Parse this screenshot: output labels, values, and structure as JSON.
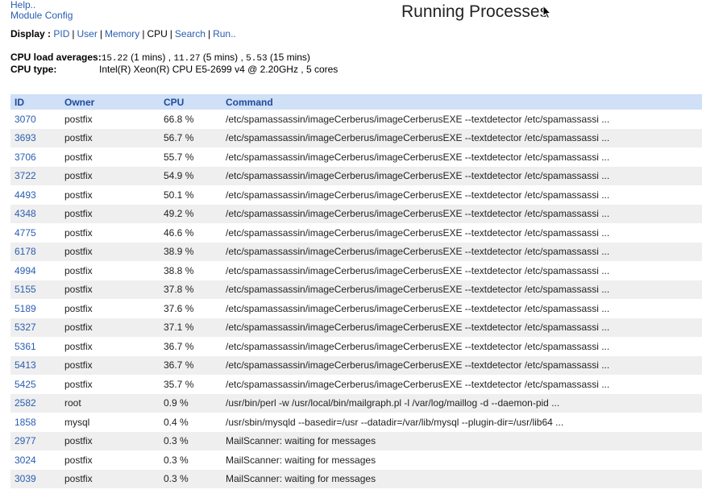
{
  "top_links": {
    "help": "Help..",
    "module_config": "Module Config"
  },
  "page_title": "Running Processes",
  "display": {
    "label": "Display :",
    "modes": [
      {
        "label": "PID",
        "current": false
      },
      {
        "label": "User",
        "current": false
      },
      {
        "label": "Memory",
        "current": false
      },
      {
        "label": "CPU",
        "current": true
      },
      {
        "label": "Search",
        "current": false
      },
      {
        "label": "Run..",
        "current": false
      }
    ]
  },
  "cpu": {
    "load_label": "CPU load averages:",
    "load_1": "15.22",
    "load_1_unit": "(1 mins)",
    "load_5": "11.27",
    "load_5_unit": "(5 mins)",
    "load_15": "5.53",
    "load_15_unit": "(15 mins)",
    "type_label": "CPU type:",
    "type_value": "Intel(R) Xeon(R) CPU E5-2699 v4 @ 2.20GHz , 5 cores"
  },
  "table": {
    "headers": [
      "ID",
      "Owner",
      "CPU",
      "Command"
    ],
    "rows": [
      [
        "3070",
        "postfix",
        "66.8 %",
        "/etc/spamassassin/imageCerberus/imageCerberusEXE --textdetector /etc/spamassassi ..."
      ],
      [
        "3693",
        "postfix",
        "56.7 %",
        "/etc/spamassassin/imageCerberus/imageCerberusEXE --textdetector /etc/spamassassi ..."
      ],
      [
        "3706",
        "postfix",
        "55.7 %",
        "/etc/spamassassin/imageCerberus/imageCerberusEXE --textdetector /etc/spamassassi ..."
      ],
      [
        "3722",
        "postfix",
        "54.9 %",
        "/etc/spamassassin/imageCerberus/imageCerberusEXE --textdetector /etc/spamassassi ..."
      ],
      [
        "4493",
        "postfix",
        "50.1 %",
        "/etc/spamassassin/imageCerberus/imageCerberusEXE --textdetector /etc/spamassassi ..."
      ],
      [
        "4348",
        "postfix",
        "49.2 %",
        "/etc/spamassassin/imageCerberus/imageCerberusEXE --textdetector /etc/spamassassi ..."
      ],
      [
        "4775",
        "postfix",
        "46.6 %",
        "/etc/spamassassin/imageCerberus/imageCerberusEXE --textdetector /etc/spamassassi ..."
      ],
      [
        "6178",
        "postfix",
        "38.9 %",
        "/etc/spamassassin/imageCerberus/imageCerberusEXE --textdetector /etc/spamassassi ..."
      ],
      [
        "4994",
        "postfix",
        "38.8 %",
        "/etc/spamassassin/imageCerberus/imageCerberusEXE --textdetector /etc/spamassassi ..."
      ],
      [
        "5155",
        "postfix",
        "37.8 %",
        "/etc/spamassassin/imageCerberus/imageCerberusEXE --textdetector /etc/spamassassi ..."
      ],
      [
        "5189",
        "postfix",
        "37.6 %",
        "/etc/spamassassin/imageCerberus/imageCerberusEXE --textdetector /etc/spamassassi ..."
      ],
      [
        "5327",
        "postfix",
        "37.1 %",
        "/etc/spamassassin/imageCerberus/imageCerberusEXE --textdetector /etc/spamassassi ..."
      ],
      [
        "5361",
        "postfix",
        "36.7 %",
        "/etc/spamassassin/imageCerberus/imageCerberusEXE --textdetector /etc/spamassassi ..."
      ],
      [
        "5413",
        "postfix",
        "36.7 %",
        "/etc/spamassassin/imageCerberus/imageCerberusEXE --textdetector /etc/spamassassi ..."
      ],
      [
        "5425",
        "postfix",
        "35.7 %",
        "/etc/spamassassin/imageCerberus/imageCerberusEXE --textdetector /etc/spamassassi ..."
      ],
      [
        "2582",
        "root",
        "0.9 %",
        "/usr/bin/perl -w /usr/local/bin/mailgraph.pl -l /var/log/maillog -d --daemon-pid ..."
      ],
      [
        "1858",
        "mysql",
        "0.4 %",
        "/usr/sbin/mysqld --basedir=/usr --datadir=/var/lib/mysql --plugin-dir=/usr/lib64 ..."
      ],
      [
        "2977",
        "postfix",
        "0.3 %",
        "MailScanner: waiting for messages"
      ],
      [
        "3024",
        "postfix",
        "0.3 %",
        "MailScanner: waiting for messages"
      ],
      [
        "3039",
        "postfix",
        "0.3 %",
        "MailScanner: waiting for messages"
      ]
    ]
  },
  "colors": {
    "link": "#2a5db0",
    "header_bg": "#cfe0f7",
    "row_alt": "#efefef"
  }
}
